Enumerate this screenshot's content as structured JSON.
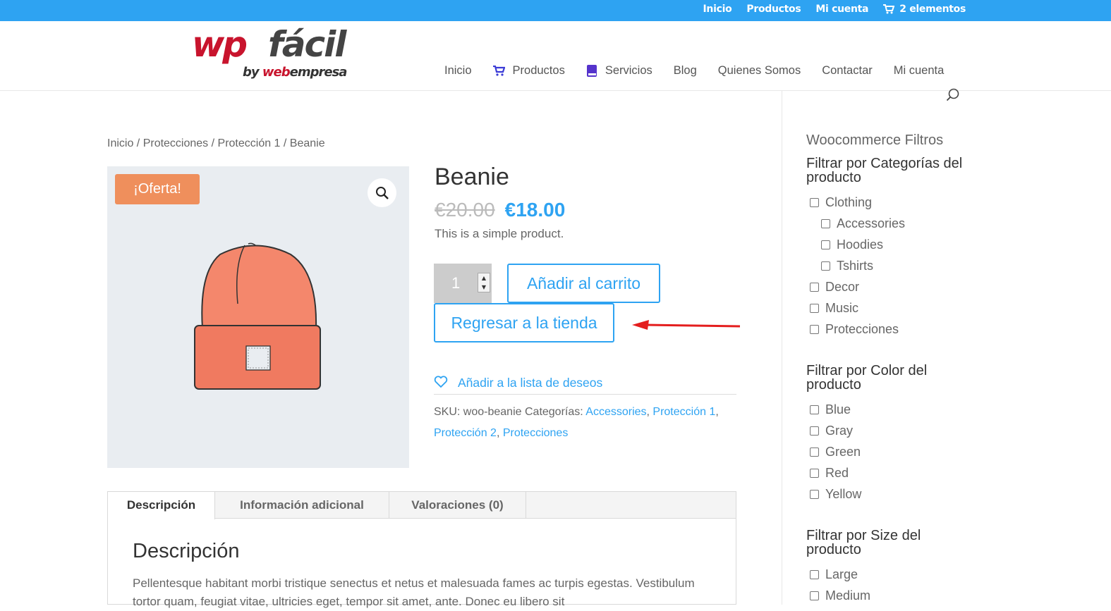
{
  "topbar": {
    "links": [
      "Inicio",
      "Productos",
      "Mi cuenta"
    ],
    "cart_label": "2 elementos",
    "bg_color": "#2ea3f2"
  },
  "logo": {
    "brand_red": "wp",
    "brand_dark": "fácil",
    "by": "by",
    "company_red": "web",
    "company_dark": "empresa"
  },
  "nav": {
    "items": [
      {
        "label": "Inicio",
        "icon": ""
      },
      {
        "label": "Productos",
        "icon": "cart-icon"
      },
      {
        "label": "Servicios",
        "icon": "book-icon"
      },
      {
        "label": "Blog",
        "icon": ""
      },
      {
        "label": "Quienes Somos",
        "icon": ""
      },
      {
        "label": "Contactar",
        "icon": ""
      },
      {
        "label": "Mi cuenta",
        "icon": ""
      }
    ],
    "search_icon": "search-icon"
  },
  "breadcrumb": "Inicio / Protecciones / Protección 1 / Beanie",
  "product": {
    "sale_badge": "¡Oferta!",
    "title": "Beanie",
    "old_price": "€20.00",
    "new_price": "€18.00",
    "short_description": "This is a simple product.",
    "quantity": "1",
    "add_to_cart": "Añadir al carrito",
    "back_to_shop": "Regresar a la tienda",
    "wishlist": "Añadir a la lista de deseos",
    "sku_label": "SKU:",
    "sku": "woo-beanie",
    "categories_label": "Categorías:",
    "categories": [
      "Accessories",
      "Protección 1",
      "Protección 2",
      "Protecciones"
    ],
    "accent_color": "#2ea3f2",
    "sale_color": "#ef8f5c"
  },
  "tabs": {
    "items": [
      "Descripción",
      "Información adicional",
      "Valoraciones (0)"
    ],
    "heading": "Descripción",
    "text": "Pellentesque habitant morbi tristique senectus et netus et malesuada fames ac turpis egestas. Vestibulum tortor quam, feugiat vitae, ultricies eget, tempor sit amet, ante. Donec eu libero sit"
  },
  "sidebar": {
    "widget_title": "Woocommerce Filtros",
    "category_filter_title": "Filtrar por Categorías del producto",
    "categories": [
      {
        "label": "Clothing",
        "level": 0
      },
      {
        "label": "Accessories",
        "level": 1
      },
      {
        "label": "Hoodies",
        "level": 1
      },
      {
        "label": "Tshirts",
        "level": 1
      },
      {
        "label": "Decor",
        "level": 0
      },
      {
        "label": "Music",
        "level": 0
      },
      {
        "label": "Protecciones",
        "level": 0
      }
    ],
    "color_filter_title": "Filtrar por Color del producto",
    "colors": [
      "Blue",
      "Gray",
      "Green",
      "Red",
      "Yellow"
    ],
    "size_filter_title": "Filtrar por Size del producto",
    "sizes": [
      "Large",
      "Medium"
    ]
  }
}
